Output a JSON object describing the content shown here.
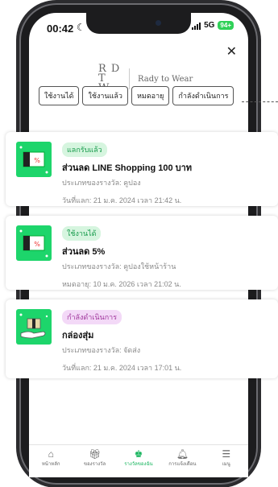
{
  "status": {
    "time": "00:42",
    "network": "5G",
    "battery": "94+"
  },
  "brand": {
    "logo_text": "RDTW",
    "name": "Rady to Wear"
  },
  "tabs": [
    {
      "label": "ใช้งานได้"
    },
    {
      "label": "ใช้งานแล้ว"
    },
    {
      "label": "หมดอายุ"
    },
    {
      "label": "กำลังดำเนินการ"
    }
  ],
  "cards": [
    {
      "badge": "แลกรับแล้ว",
      "title": "ส่วนลด LINE Shopping 100 บาท",
      "type": "ประเภทของรางวัล: คูปอง",
      "date": "วันที่แลก: 21 ม.ค. 2024 เวลา 21:42 น.",
      "icon": "coupon-icon",
      "color": "#1dd56b"
    },
    {
      "badge": "ใช้งานได้",
      "title": "ส่วนลด 5%",
      "type": "ประเภทของรางวัล: คูปองใช้หน้าร้าน",
      "date": "หมดอายุ: 10 ม.ค. 2026 เวลา 21:02 น.",
      "icon": "coupon-icon",
      "color": "#1dd56b"
    },
    {
      "badge": "กำลังดำเนินการ",
      "title": "กล่องสุ่ม",
      "type": "ประเภทของรางวัล: จัดส่ง",
      "date": "วันที่แลก: 21 ม.ค. 2024 เวลา 17:01 น.",
      "icon": "gift-box-hand-icon",
      "color": "#1dd56b"
    }
  ],
  "nav": [
    {
      "label": "หน้าหลัก",
      "icon": "home-icon"
    },
    {
      "label": "ของรางวัล",
      "icon": "gift-icon"
    },
    {
      "label": "รางวัลของฉัน",
      "icon": "reward-icon"
    },
    {
      "label": "การแจ้งเตือน",
      "icon": "bell-icon"
    },
    {
      "label": "เมนู",
      "icon": "menu-icon"
    }
  ],
  "colors": {
    "accent": "#12b35a",
    "badge_green": "#d6f5df",
    "badge_purple": "#f3d9f7"
  }
}
